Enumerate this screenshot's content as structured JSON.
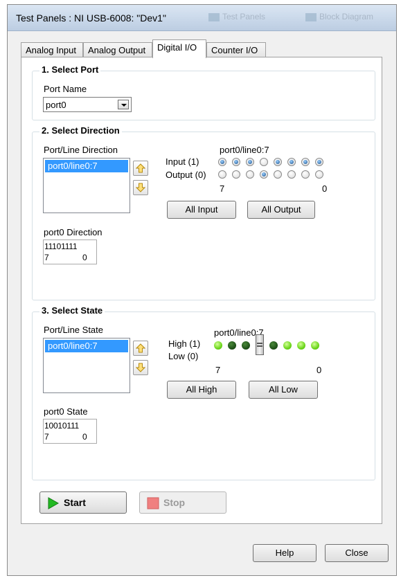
{
  "window": {
    "title": "Test Panels : NI USB-6008: \"Dev1\"",
    "background_titles": [
      "Test Panels",
      "Block Diagram"
    ]
  },
  "tabs": [
    {
      "label": "Analog Input",
      "active": false
    },
    {
      "label": "Analog Output",
      "active": false
    },
    {
      "label": "Digital I/O",
      "active": true
    },
    {
      "label": "Counter I/O",
      "active": false
    }
  ],
  "select_port": {
    "title": "1. Select Port",
    "port_name_label": "Port Name",
    "port_name_value": "port0"
  },
  "select_direction": {
    "title": "2. Select Direction",
    "list_label": "Port/Line Direction",
    "list_items": [
      "port0/line0:7"
    ],
    "lines_label": "port0/line0:7",
    "input_label": "Input (1)",
    "output_label": "Output (0)",
    "bit_high": "7",
    "bit_low": "0",
    "input_states": [
      true,
      true,
      true,
      false,
      true,
      true,
      true,
      true
    ],
    "all_input": "All Input",
    "all_output": "All Output",
    "direction_label": "port0 Direction",
    "direction_bits": "11101111",
    "dir_hi": "7",
    "dir_lo": "0"
  },
  "select_state": {
    "title": "3. Select State",
    "list_label": "Port/Line State",
    "list_items": [
      "port0/line0:7"
    ],
    "lines_label": "port0/line0:7",
    "high_label": "High (1)",
    "low_label": "Low (0)",
    "bit_high": "7",
    "bit_low": "0",
    "states": [
      1,
      0,
      0,
      "output",
      0,
      1,
      1,
      1
    ],
    "all_high": "All High",
    "all_low": "All Low",
    "state_label": "port0 State",
    "state_bits": "10010111",
    "st_hi": "7",
    "st_lo": "0"
  },
  "controls": {
    "start": "Start",
    "stop": "Stop",
    "help": "Help",
    "close": "Close"
  },
  "colors": {
    "selection": "#3399ff",
    "led_high": "#6bd61a",
    "led_low": "#1a4a14",
    "start_icon": "#22b922",
    "stop_icon": "#f08080"
  }
}
